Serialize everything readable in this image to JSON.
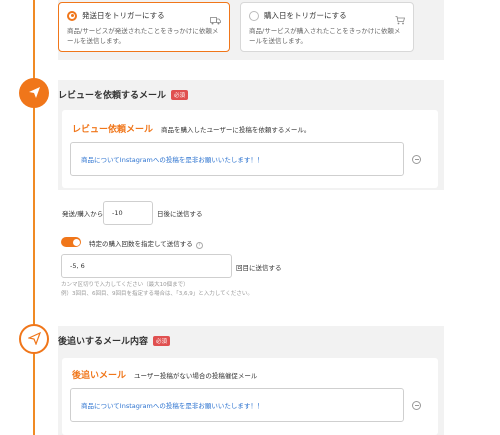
{
  "triggers": [
    {
      "title": "発送日をトリガーにする",
      "description": "商品/サービスが発送されたことをきっかけに依頼メールを送信します。",
      "icon": "truck-icon",
      "selected": true
    },
    {
      "title": "購入日をトリガーにする",
      "description": "商品/サービスが購入されたことをきっかけに依頼メールを送信します。",
      "icon": "cart-icon",
      "selected": false
    }
  ],
  "review_section": {
    "title": "レビューを依頼するメール",
    "badge": "必須",
    "icon": "paper-plane-icon",
    "card_heading": "レビュー依頼メール",
    "card_subheading": "商品を購入したユーザーに投稿を依頼するメール。",
    "message": "商品についてInstagramへの投稿を是非お願いいたします！！",
    "send_prefix": "発送/購入から",
    "send_days": "-10",
    "send_suffix": "日後に送信する",
    "toggle_on": true,
    "toggle_label": "特定の購入回数を指定して送信する",
    "count_value": "-5, 6",
    "count_suffix": "回目に送信する",
    "hint_line1": "カンマ区切りで入力してください（最大10個まで）",
    "hint_line2": "例）3回目、6回目、9回目を指定する場合は、「3,6,9」と入力してください。"
  },
  "followup_section": {
    "title": "後追いするメール内容",
    "badge": "必須",
    "icon": "paper-plane-icon",
    "card_heading": "後追いメール",
    "card_subheading": "ユーザー投稿がない場合の投稿催促メール",
    "message": "商品についてInstagramへの投稿を是非お願いいたします！！"
  },
  "colors": {
    "accent": "#f0761a",
    "link": "#2e74d0",
    "required_badge": "#e05050"
  }
}
